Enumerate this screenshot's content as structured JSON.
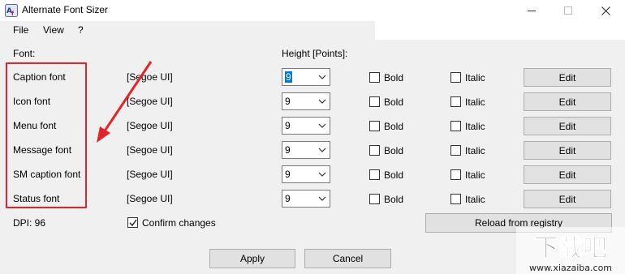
{
  "window": {
    "title": "Alternate Font Sizer"
  },
  "menu": {
    "file": "File",
    "view": "View",
    "help": "?"
  },
  "labels": {
    "font_header": "Font:",
    "height_header": "Height [Points]:"
  },
  "rows": [
    {
      "name": "Caption font",
      "face": "[Segoe UI]",
      "size": "9",
      "bold": "Bold",
      "italic": "Italic",
      "edit": "Edit"
    },
    {
      "name": "Icon font",
      "face": "[Segoe UI]",
      "size": "9",
      "bold": "Bold",
      "italic": "Italic",
      "edit": "Edit"
    },
    {
      "name": "Menu font",
      "face": "[Segoe UI]",
      "size": "9",
      "bold": "Bold",
      "italic": "Italic",
      "edit": "Edit"
    },
    {
      "name": "Message font",
      "face": "[Segoe UI]",
      "size": "9",
      "bold": "Bold",
      "italic": "Italic",
      "edit": "Edit"
    },
    {
      "name": "SM caption font",
      "face": "[Segoe UI]",
      "size": "9",
      "bold": "Bold",
      "italic": "Italic",
      "edit": "Edit"
    },
    {
      "name": "Status font",
      "face": "[Segoe UI]",
      "size": "9",
      "bold": "Bold",
      "italic": "Italic",
      "edit": "Edit"
    }
  ],
  "footer": {
    "dpi": "DPI: 96",
    "confirm_changes": "Confirm changes",
    "reload": "Reload from registry",
    "apply": "Apply",
    "cancel": "Cancel"
  },
  "watermark": {
    "main": "下载吧",
    "url": "www.xiazaiba.com"
  },
  "colors": {
    "annotation": "#e3242b",
    "selection": "#0078d7",
    "dialog_bg": "#f0f0f0"
  }
}
